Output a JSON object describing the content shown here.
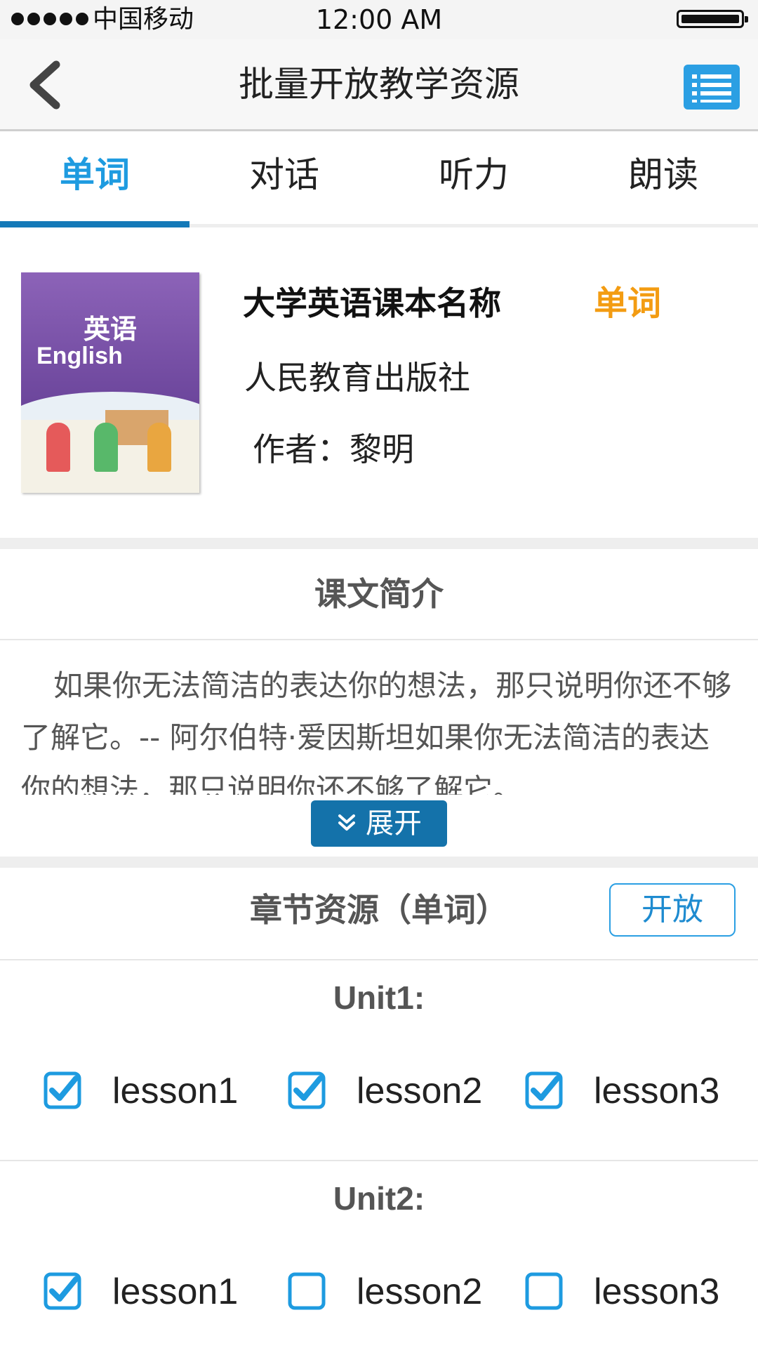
{
  "status_bar": {
    "carrier": "中国移动",
    "time": "12:00 AM"
  },
  "nav": {
    "title": "批量开放教学资源",
    "back_icon": "chevron-left-icon",
    "menu_icon": "list-icon"
  },
  "tabs": [
    {
      "label": "单词",
      "active": true
    },
    {
      "label": "对话",
      "active": false
    },
    {
      "label": "听力",
      "active": false
    },
    {
      "label": "朗读",
      "active": false
    }
  ],
  "book": {
    "title": "大学英语课本名称",
    "tag": "单词",
    "publisher": "人民教育出版社",
    "author": "作者：黎明",
    "cover": {
      "title_zh": "英语",
      "title_en": "English"
    }
  },
  "summary": {
    "heading": "课文简介",
    "text": "如果你无法简洁的表达你的想法，那只说明你还不够了解它。-- 阿尔伯特·爱因斯坦如果你无法简洁的表达你的想法，那只说明你还不够了解它。",
    "expand_label": "展开"
  },
  "chapters": {
    "heading": "章节资源（单词）",
    "open_label": "开放",
    "units": [
      {
        "label": "Unit1:",
        "lessons": [
          {
            "label": "lesson1",
            "checked": true
          },
          {
            "label": "lesson2",
            "checked": true
          },
          {
            "label": "lesson3",
            "checked": true
          }
        ]
      },
      {
        "label": "Unit2:",
        "lessons": [
          {
            "label": "lesson1",
            "checked": true
          },
          {
            "label": "lesson2",
            "checked": false
          },
          {
            "label": "lesson3",
            "checked": false
          }
        ]
      }
    ]
  },
  "colors": {
    "accent": "#1e9be0",
    "tab_indicator": "#1479b8",
    "tag": "#f39c12",
    "expand_button": "#1472aa"
  }
}
